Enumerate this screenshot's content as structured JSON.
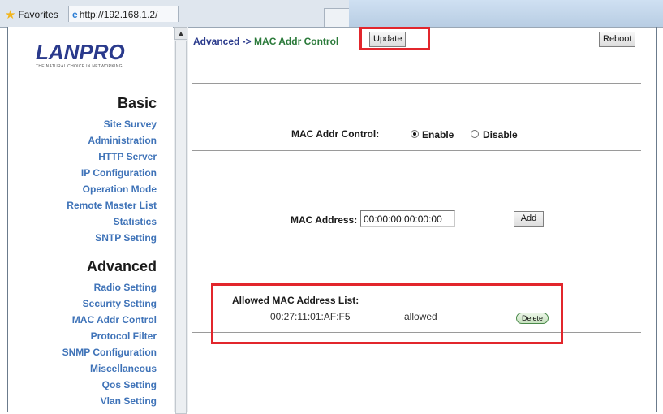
{
  "browser": {
    "favorites_label": "Favorites",
    "address": "http://192.168.1.2/"
  },
  "logo": {
    "name": "LANPRO",
    "tagline": "THE NATURAL CHOICE IN NETWORKING"
  },
  "sidebar": {
    "basic_heading": "Basic",
    "basic_items": [
      "Site Survey",
      "Administration",
      "HTTP Server",
      "IP Configuration",
      "Operation Mode",
      "Remote Master List",
      "Statistics",
      "SNTP Setting"
    ],
    "advanced_heading": "Advanced",
    "advanced_items": [
      "Radio Setting",
      "Security Setting",
      "MAC Addr Control",
      "Protocol Filter",
      "SNMP Configuration",
      "Miscellaneous",
      "Qos Setting",
      "Vlan Setting"
    ]
  },
  "header": {
    "crumb_section": "Advanced ->",
    "crumb_page": "MAC Addr Control",
    "update_label": "Update",
    "reboot_label": "Reboot"
  },
  "control": {
    "label": "MAC Addr Control:",
    "enable_label": "Enable",
    "disable_label": "Disable",
    "selected": "Enable"
  },
  "address_form": {
    "label": "MAC Address:",
    "value": "00:00:00:00:00:00",
    "add_label": "Add"
  },
  "allowed_list": {
    "title": "Allowed MAC Address List:",
    "entries": [
      {
        "mac": "00:27:11:01:AF:F5",
        "status": "allowed",
        "action": "Delete"
      }
    ]
  },
  "colors": {
    "highlight": "#e2262c",
    "nav_link": "#3f73b8",
    "crumb_page": "#2b7a3a"
  }
}
